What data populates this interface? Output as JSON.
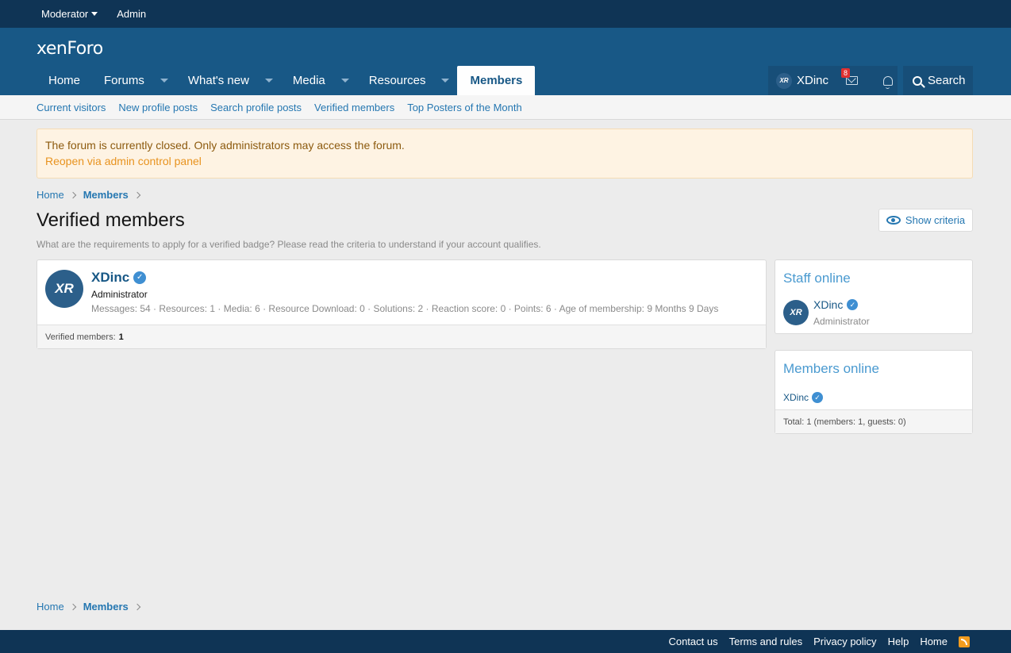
{
  "staffbar": {
    "moderator": "Moderator",
    "admin": "Admin"
  },
  "header": {
    "logo": "xenForo"
  },
  "nav": {
    "tabs": [
      {
        "label": "Home"
      },
      {
        "label": "Forums"
      },
      {
        "label": "What's new"
      },
      {
        "label": "Media"
      },
      {
        "label": "Resources"
      },
      {
        "label": "Members"
      }
    ],
    "user": {
      "name": "XDinc",
      "avatar_text": "XR",
      "inbox_count": "8"
    },
    "search_label": "Search"
  },
  "subnav": {
    "items": [
      "Current visitors",
      "New profile posts",
      "Search profile posts",
      "Verified members",
      "Top Posters of the Month"
    ]
  },
  "notice": {
    "message": "The forum is currently closed. Only administrators may access the forum.",
    "link": "Reopen via admin control panel"
  },
  "breadcrumb": {
    "home": "Home",
    "members": "Members"
  },
  "page": {
    "title": "Verified members",
    "description": "What are the requirements to apply for a verified badge? Please read the criteria to understand if your account qualifies.",
    "criteria_button": "Show criteria"
  },
  "member": {
    "name": "XDinc",
    "avatar_text": "XR",
    "title": "Administrator",
    "stats": "Messages: 54 · Resources: 1 · Media: 6 · Resource Download: 0 · Solutions: 2 · Reaction score: 0 · Points: 6 · Age of membership: 9 Months 9 Days",
    "verified_check": "✓"
  },
  "main_footer": {
    "label": "Verified members:",
    "count": "1"
  },
  "staff_online": {
    "title": "Staff online",
    "name": "XDinc",
    "avatar_text": "XR",
    "role": "Administrator"
  },
  "members_online": {
    "title": "Members online",
    "name": "XDinc",
    "total": "Total: 1 (members: 1, guests: 0)"
  },
  "footer": {
    "links": [
      "Contact us",
      "Terms and rules",
      "Privacy policy",
      "Help",
      "Home"
    ]
  },
  "colors": {
    "header": "#185886",
    "staffbar": "#0f3455",
    "accent": "#2577b1",
    "notice_bg": "#fef3e3"
  }
}
